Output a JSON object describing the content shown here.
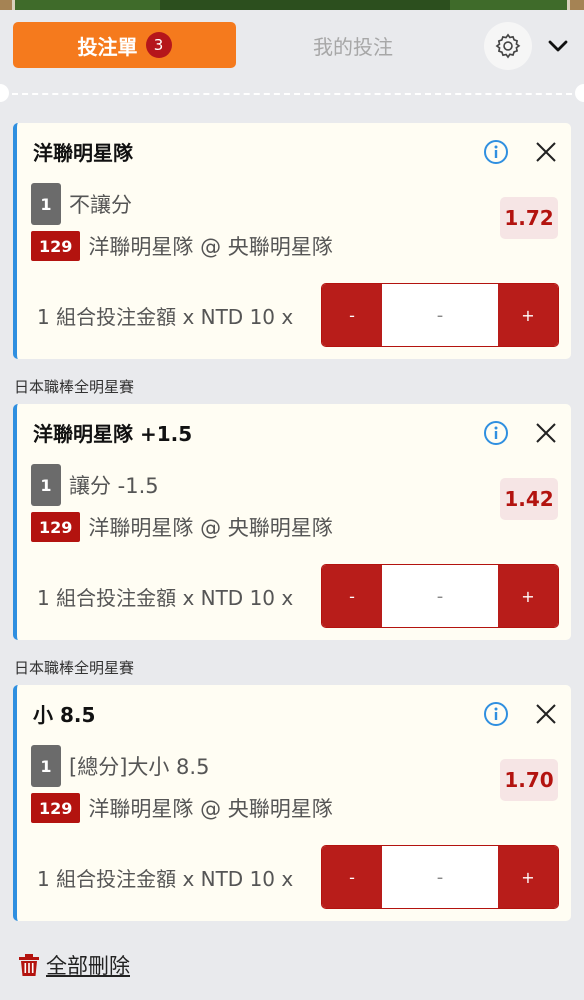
{
  "header": {
    "tab_betslip": "投注單",
    "tab_betslip_count": "3",
    "tab_mybets": "我的投注"
  },
  "bets": [
    {
      "league": "",
      "title": "洋聯明星隊",
      "line_number": "1",
      "market": "不讓分",
      "match_code": "129",
      "match": "洋聯明星隊 @ 央聯明星隊",
      "odds": "1.72",
      "stake_label": "1 組合投注金額 x NTD 10 x",
      "stepper": {
        "minus": "-",
        "value": "-",
        "plus": "+"
      }
    },
    {
      "league": "日本職棒全明星賽",
      "title": "洋聯明星隊 +1.5",
      "line_number": "1",
      "market": "讓分 -1.5",
      "match_code": "129",
      "match": "洋聯明星隊 @ 央聯明星隊",
      "odds": "1.42",
      "stake_label": "1 組合投注金額 x NTD 10 x",
      "stepper": {
        "minus": "-",
        "value": "-",
        "plus": "+"
      }
    },
    {
      "league": "日本職棒全明星賽",
      "title": "小 8.5",
      "line_number": "1",
      "market": "[總分]大小 8.5",
      "match_code": "129",
      "match": "洋聯明星隊 @ 央聯明星隊",
      "odds": "1.70",
      "stake_label": "1 組合投注金額 x NTD 10 x",
      "stepper": {
        "minus": "-",
        "value": "-",
        "plus": "+"
      }
    }
  ],
  "footer": {
    "delete_all": "全部刪除"
  },
  "colors": {
    "accent_orange": "#f57a1d",
    "brand_red": "#b3130f",
    "info_blue": "#2f8fe0"
  }
}
